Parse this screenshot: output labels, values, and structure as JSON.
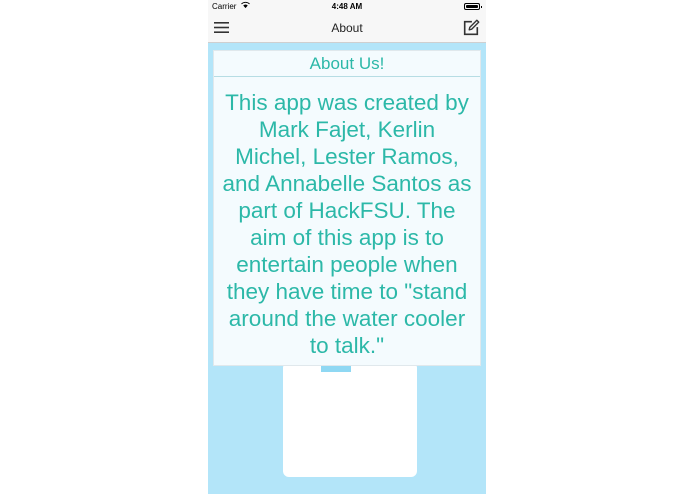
{
  "status_bar": {
    "carrier": "Carrier",
    "time": "4:48 AM"
  },
  "nav": {
    "title": "About",
    "menu_icon": "hamburger-menu-icon",
    "edit_icon": "compose-icon"
  },
  "about": {
    "title": "About Us!",
    "body": "This app was created by Mark Fajet, Kerlin Michel, Lester Ramos, and Annabelle Santos as part of HackFSU. The aim of this app is to entertain people when they have time to \"stand around the water cooler to talk.\""
  },
  "colors": {
    "background": "#b3e5f9",
    "accent_text": "#2cb8a8",
    "card": "#f4fbfe"
  }
}
